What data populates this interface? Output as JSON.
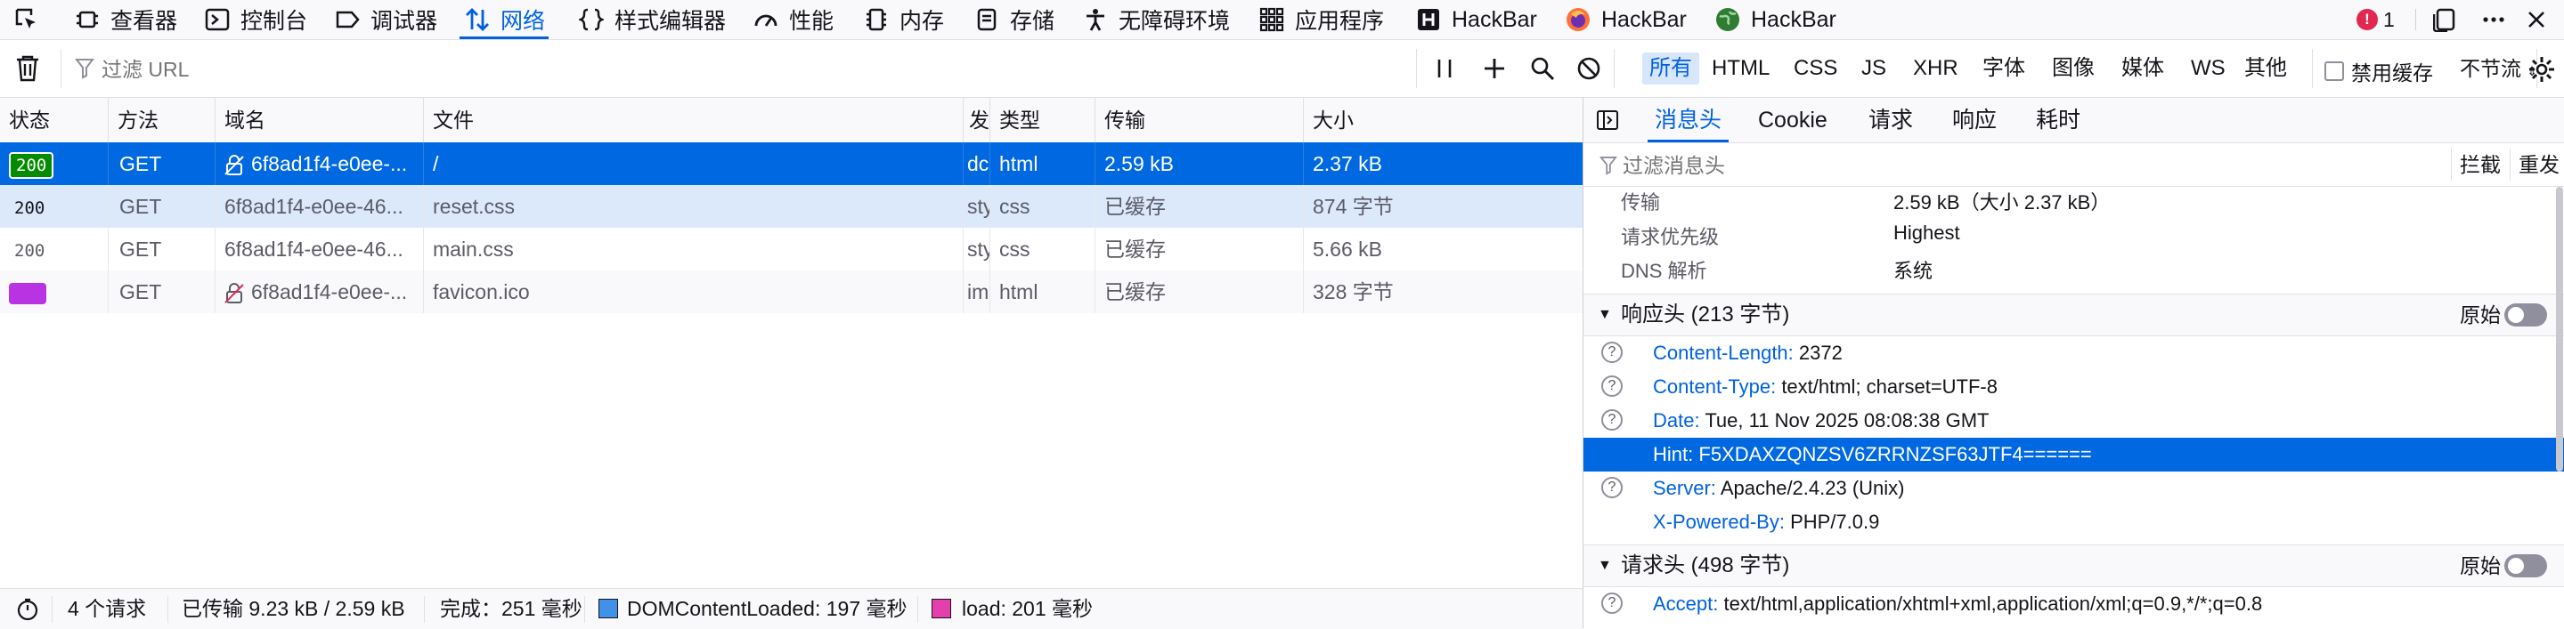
{
  "toolbar": {
    "tabs": [
      {
        "label": "查看器",
        "icon": "inspector-icon"
      },
      {
        "label": "控制台",
        "icon": "console-icon"
      },
      {
        "label": "调试器",
        "icon": "debugger-icon"
      },
      {
        "label": "网络",
        "icon": "network-icon",
        "active": true
      },
      {
        "label": "样式编辑器",
        "icon": "style-editor-icon"
      },
      {
        "label": "性能",
        "icon": "performance-icon"
      },
      {
        "label": "内存",
        "icon": "memory-icon"
      },
      {
        "label": "存储",
        "icon": "storage-icon"
      },
      {
        "label": "无障碍环境",
        "icon": "accessibility-icon"
      },
      {
        "label": "应用程序",
        "icon": "application-icon"
      },
      {
        "label": "HackBar",
        "icon": "hackbar-h-icon"
      },
      {
        "label": "HackBar",
        "icon": "hackbar-fire-icon"
      },
      {
        "label": "HackBar",
        "icon": "hackbar-globe-icon"
      }
    ],
    "error_count": "1"
  },
  "filter": {
    "placeholder": "过滤 URL",
    "types": [
      "所有",
      "HTML",
      "CSS",
      "JS",
      "XHR",
      "字体",
      "图像",
      "媒体",
      "WS",
      "其他"
    ],
    "disable_cache_label": "禁用缓存",
    "throttle_label": "不节流"
  },
  "table": {
    "headers": [
      "状态",
      "方法",
      "域名",
      "文件",
      "发",
      "类型",
      "传输",
      "大小"
    ],
    "rows": [
      {
        "status": "200",
        "method": "GET",
        "domain": "6f8ad1f4-e0ee-...",
        "file": "/",
        "initiator": "dc",
        "type": "html",
        "transfer": "2.59 kB",
        "size": "2.37 kB",
        "selected": true
      },
      {
        "status": "200",
        "method": "GET",
        "domain": "6f8ad1f4-e0ee-46...",
        "file": "reset.css",
        "initiator": "sty",
        "type": "css",
        "transfer": "已缓存",
        "size": "874 字节",
        "highlight": true
      },
      {
        "status": "200",
        "method": "GET",
        "domain": "6f8ad1f4-e0ee-46...",
        "file": "main.css",
        "initiator": "sty",
        "type": "css",
        "transfer": "已缓存",
        "size": "5.66 kB"
      },
      {
        "status": "",
        "method": "GET",
        "domain": "6f8ad1f4-e0ee-...",
        "file": "favicon.ico",
        "initiator": "im",
        "type": "html",
        "transfer": "已缓存",
        "size": "328 字节"
      }
    ]
  },
  "statusbar": {
    "requests": "4 个请求",
    "transferred": "已传输 9.23 kB / 2.59 kB",
    "finish": "完成：251 毫秒",
    "domcontentloaded": "DOMContentLoaded: 197 毫秒",
    "load": "load: 201 毫秒"
  },
  "panel": {
    "tabs": [
      "消息头",
      "Cookie",
      "请求",
      "响应",
      "耗时"
    ],
    "filter_placeholder": "过滤消息头",
    "block_label": "拦截",
    "resend_label": "重发",
    "summary": [
      {
        "key": "传输",
        "value": "2.59 kB（大小 2.37 kB）"
      },
      {
        "key": "请求优先级",
        "value": "Highest"
      },
      {
        "key": "DNS 解析",
        "value": "系统"
      }
    ],
    "response_section": "响应头 (213 字节)",
    "raw_label": "原始",
    "response_headers": [
      {
        "name": "Content-Length:",
        "value": "2372"
      },
      {
        "name": "Content-Type:",
        "value": "text/html; charset=UTF-8"
      },
      {
        "name": "Date:",
        "value": "Tue, 11 Nov 2025 08:08:38 GMT"
      },
      {
        "name": "Hint:",
        "value": "F5XDAXZQNZSV6ZRRNZSF63JTF4======",
        "selected": true
      },
      {
        "name": "Server:",
        "value": "Apache/2.4.23 (Unix)"
      },
      {
        "name": "X-Powered-By:",
        "value": "PHP/7.0.9"
      }
    ],
    "request_section": "请求头 (498 字节)",
    "request_headers": [
      {
        "name": "Accept:",
        "value": "text/html,application/xhtml+xml,application/xml;q=0.9,*/*;q=0.8"
      }
    ]
  },
  "colors": {
    "accent": "#0061e0",
    "selected_row": "#0068e0",
    "highlight_row": "#dbe9fb",
    "badge_green": "#058b00",
    "badge_purple": "#b833e1"
  }
}
